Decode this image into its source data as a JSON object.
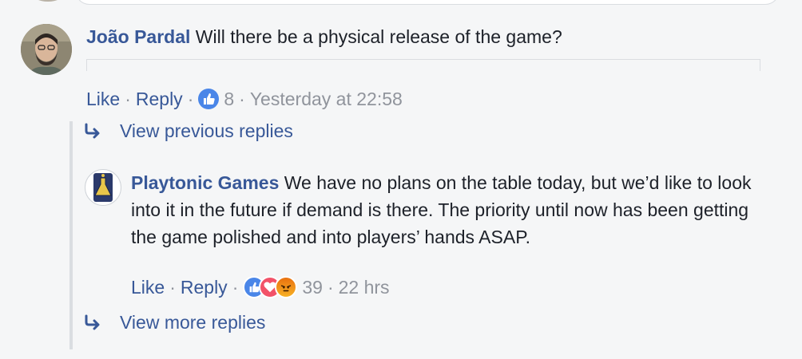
{
  "comment": {
    "author": "João Pardal",
    "text": "Will there be a physical release of the game?",
    "actions": {
      "like": "Like",
      "reply": "Reply",
      "reaction_count": "8",
      "timestamp": "Yesterday at 22:58"
    }
  },
  "replies": {
    "view_previous": "View previous replies",
    "reply": {
      "author": "Playtonic Games",
      "text": "We have no plans on the table today, but we’d like to look into it in the future if demand is there. The priority until now has been getting the game polished and into players’ hands ASAP.",
      "actions": {
        "like": "Like",
        "reply": "Reply",
        "reaction_count": "39",
        "timestamp": "22 hrs"
      }
    },
    "view_more": "View more replies"
  },
  "separator": "·",
  "colors": {
    "link": "#385898",
    "meta": "#90949c",
    "like_reaction": "#4a86e8",
    "love_reaction": "#f25268",
    "angry_reaction": "#f0901c"
  }
}
